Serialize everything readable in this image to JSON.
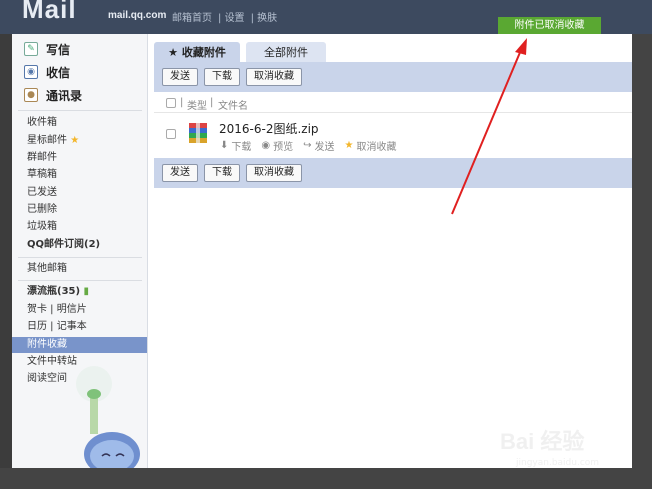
{
  "header": {
    "logo": "Mail",
    "domain": "mail.qq.com",
    "links": [
      "邮箱首页",
      "设置",
      "换肤"
    ]
  },
  "toast": {
    "text": "附件已取消收藏",
    "color": "#5aa832"
  },
  "sidebar": {
    "compose": "写信",
    "inbox": "收信",
    "contacts": "通讯录",
    "folders": [
      "收件箱",
      "星标邮件",
      "群邮件",
      "草稿箱",
      "已发送",
      "已删除",
      "垃圾箱",
      "QQ邮件订阅(2)"
    ],
    "other_mailbox": "其他邮箱",
    "drift_bottle": "漂流瓶(35)",
    "greeting_card": "贺卡",
    "postcard": "明信片",
    "calendar": "日历",
    "notepad": "记事本",
    "attachment_fav": "附件收藏",
    "file_transfer": "文件中转站",
    "reading_space": "阅读空间",
    "active_color": "#7994ca"
  },
  "tabs": [
    "★ 收藏附件",
    "全部附件"
  ],
  "toolbar": {
    "send": "发送",
    "download": "下载",
    "unfavorite": "取消收藏"
  },
  "columns": {
    "type": "类型",
    "filename": "文件名"
  },
  "file": {
    "name": "2016-6-2图纸.zip",
    "actions": {
      "download": "下载",
      "preview": "预览",
      "send": "发送",
      "unfavorite": "取消收藏"
    }
  },
  "watermark": {
    "brand": "Bai 经验",
    "url": "jingyan.baidu.com"
  }
}
